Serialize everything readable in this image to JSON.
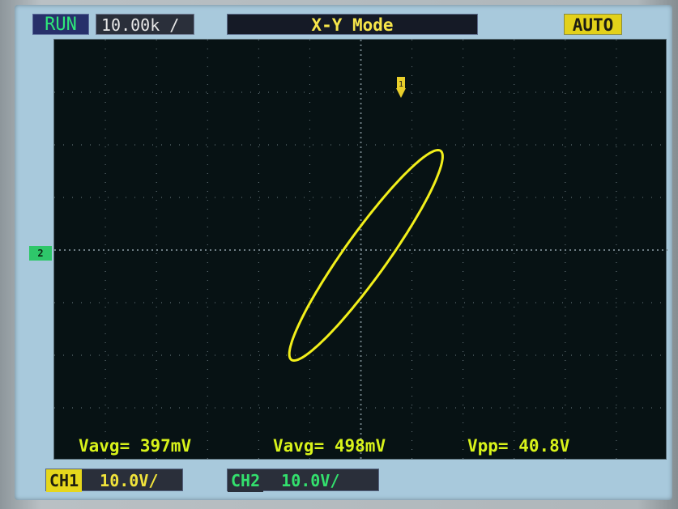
{
  "status": {
    "run_label": "RUN",
    "timebase_label": "10.00k /",
    "mode_label": "X-Y  Mode",
    "trigger_mode": "AUTO"
  },
  "markers": {
    "channel2_marker": "2",
    "trigger_marker_label": "1"
  },
  "measurements": [
    {
      "label": "Vavg=",
      "value": "397mV"
    },
    {
      "label": "Vavg=",
      "value": "498mV"
    },
    {
      "label": "Vpp=",
      "value": "40.8V"
    }
  ],
  "channels": [
    {
      "label": "CH1",
      "scale": "10.0V/"
    },
    {
      "label": "CH2",
      "scale": "10.0V/"
    }
  ],
  "colors": {
    "trace": "#f2ef1a",
    "measurement": "#d8f31a",
    "channel2": "#33e06d",
    "grid": "#6e7d84"
  }
}
